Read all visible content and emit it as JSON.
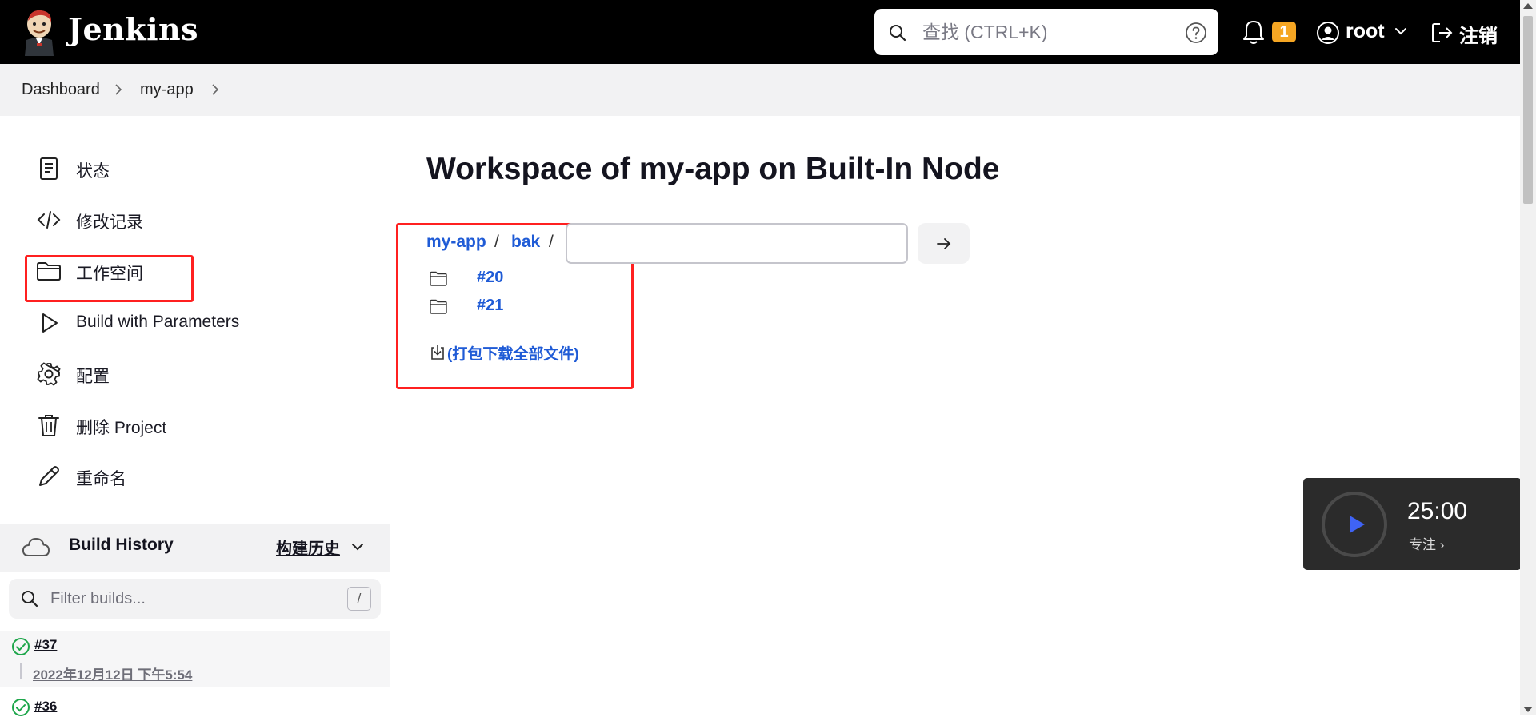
{
  "header": {
    "brand": "Jenkins",
    "search_placeholder": "查找 (CTRL+K)",
    "notification_count": "1",
    "user": "root",
    "logout": "注销"
  },
  "breadcrumb": {
    "items": [
      "Dashboard",
      "my-app"
    ]
  },
  "sidebar": {
    "items": [
      {
        "label": "状态",
        "icon": "document-icon"
      },
      {
        "label": "修改记录",
        "icon": "code-icon"
      },
      {
        "label": "工作空间",
        "icon": "folder-icon"
      },
      {
        "label": "Build with Parameters",
        "icon": "play-icon"
      },
      {
        "label": "配置",
        "icon": "gear-icon"
      },
      {
        "label": "删除 Project",
        "icon": "trash-icon"
      },
      {
        "label": "重命名",
        "icon": "pencil-icon"
      }
    ]
  },
  "build_history": {
    "title": "Build History",
    "trend_label": "构建历史",
    "filter_placeholder": "Filter builds...",
    "filter_shortcut": "/",
    "builds": [
      {
        "number": "#37",
        "date": "2022年12月12日 下午5:54",
        "status": "success"
      },
      {
        "number": "#36",
        "status": "success"
      }
    ]
  },
  "main": {
    "title": "Workspace of my-app on Built-In Node",
    "path": [
      "my-app",
      "bak"
    ],
    "path_separator": "/",
    "path_input_value": "",
    "entries": [
      {
        "name": "#20",
        "type": "folder"
      },
      {
        "name": "#21",
        "type": "folder"
      }
    ],
    "zip_label": "(打包下载全部文件)"
  },
  "timer": {
    "time": "25:00",
    "mode": "专注 ›"
  },
  "colors": {
    "header_bg": "#000000",
    "link": "#1f5bd6",
    "badge": "#f5a623",
    "highlight": "#ff2020",
    "success": "#1ea64b"
  }
}
